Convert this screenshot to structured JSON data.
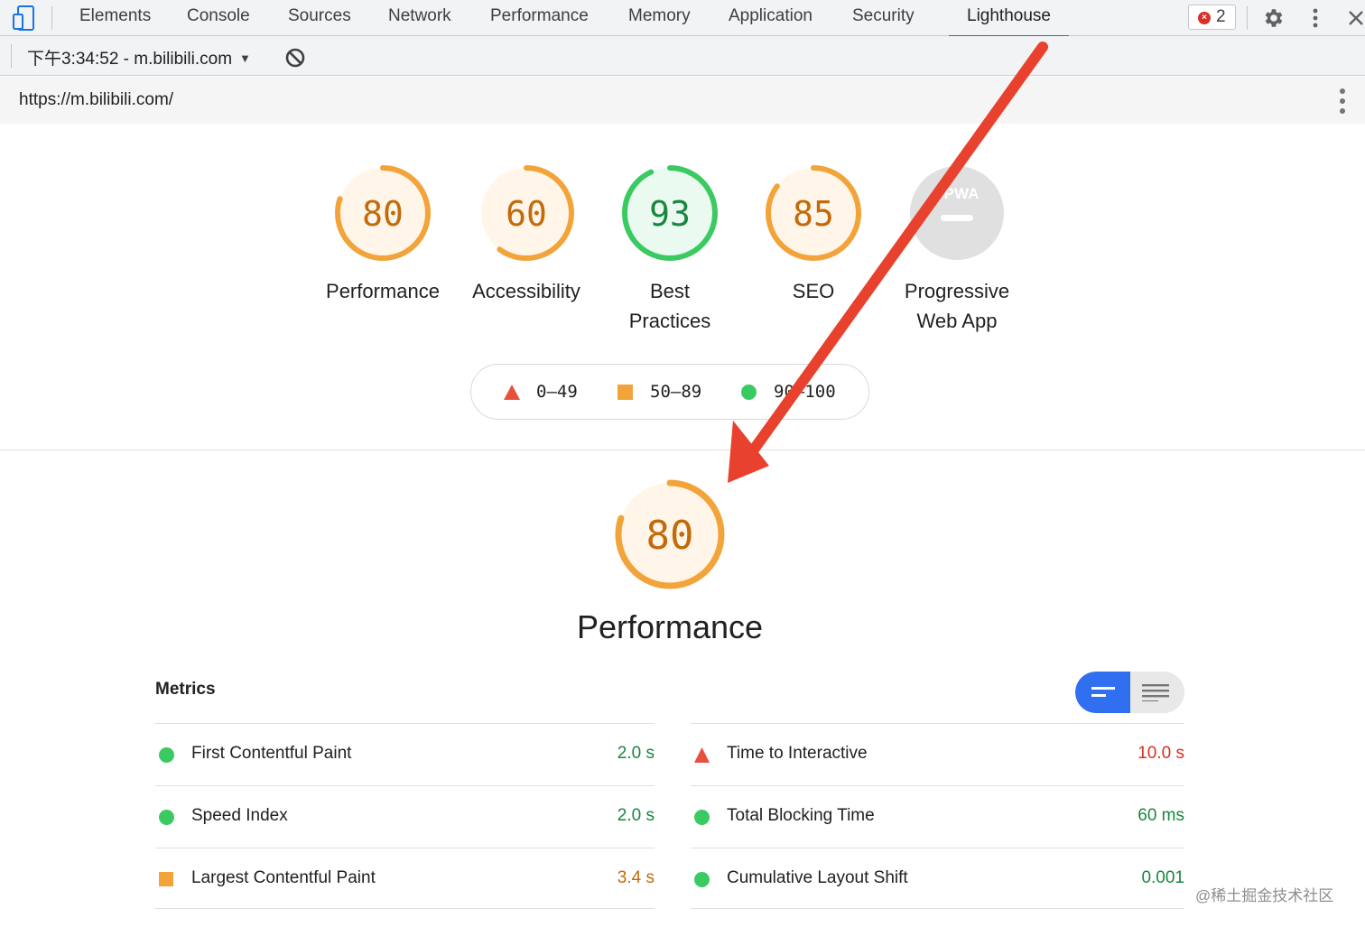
{
  "tabs": [
    {
      "label": "Elements"
    },
    {
      "label": "Console"
    },
    {
      "label": "Sources"
    },
    {
      "label": "Network"
    },
    {
      "label": "Performance"
    },
    {
      "label": "Memory"
    },
    {
      "label": "Application"
    },
    {
      "label": "Security"
    },
    {
      "label": "Lighthouse",
      "active": true
    }
  ],
  "toolbar": {
    "error_count": "2"
  },
  "report": {
    "selected": "下午3:34:52 - m.bilibili.com"
  },
  "url": "https://m.bilibili.com/",
  "categories": [
    {
      "label": "Performance",
      "score": "80",
      "fraction": 0.8,
      "color": "#f2a33a",
      "fill": "#fff6e9",
      "text": "#c36b0a"
    },
    {
      "label": "Accessibility",
      "score": "60",
      "fraction": 0.6,
      "color": "#f2a33a",
      "fill": "#fff6e9",
      "text": "#c36b0a"
    },
    {
      "label_line1": "Best",
      "label_line2": "Practices",
      "score": "93",
      "fraction": 0.93,
      "color": "#3bca62",
      "fill": "#eafaf0",
      "text": "#18863e"
    },
    {
      "label": "SEO",
      "score": "85",
      "fraction": 0.85,
      "color": "#f2a33a",
      "fill": "#fff6e9",
      "text": "#c36b0a"
    },
    {
      "label_line1": "Progressive",
      "label_line2": "Web App",
      "badge": "PWA"
    }
  ],
  "legend": [
    {
      "range": "0–49",
      "shape": "triangle",
      "color": "#e9503b"
    },
    {
      "range": "50–89",
      "shape": "square",
      "color": "#f2a33a"
    },
    {
      "range": "90–100",
      "shape": "circle",
      "color": "#3bca62"
    }
  ],
  "performance": {
    "score": "80",
    "fraction": 0.8,
    "title": "Performance"
  },
  "metrics": {
    "title": "Metrics",
    "left": [
      {
        "name": "First Contentful Paint",
        "value": "2.0 s",
        "status": "pass"
      },
      {
        "name": "Speed Index",
        "value": "2.0 s",
        "status": "pass"
      },
      {
        "name": "Largest Contentful Paint",
        "value": "3.4 s",
        "status": "average"
      }
    ],
    "right": [
      {
        "name": "Time to Interactive",
        "value": "10.0 s",
        "status": "fail"
      },
      {
        "name": "Total Blocking Time",
        "value": "60 ms",
        "status": "pass"
      },
      {
        "name": "Cumulative Layout Shift",
        "value": "0.001",
        "status": "pass"
      }
    ]
  },
  "status_colors": {
    "pass": "#18863e",
    "average": "#c36b0a",
    "fail": "#d8301f",
    "pass_icon": "#3bca62",
    "average_icon": "#f2a33a",
    "fail_icon": "#e9503b"
  },
  "annotation_color": "#e8412d",
  "watermark": "@稀土掘金技术社区"
}
